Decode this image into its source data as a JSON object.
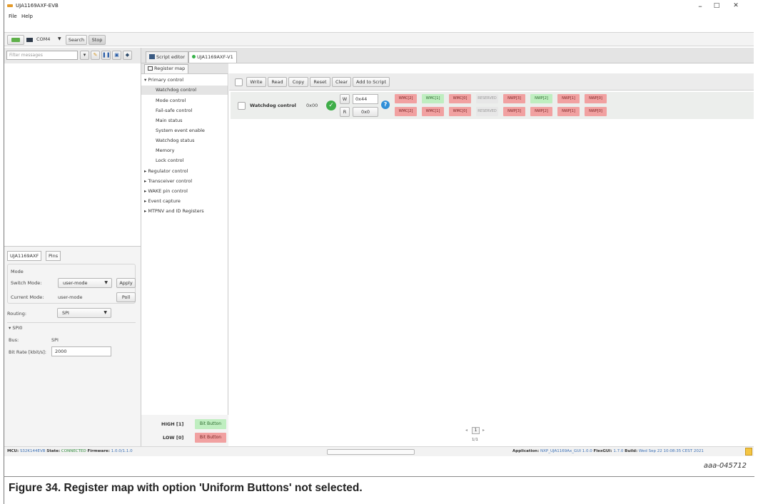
{
  "window": {
    "title": "UJA1169AXF-EVB",
    "min": "–",
    "max": "□",
    "close": "✕"
  },
  "menu": [
    "File",
    "Help"
  ],
  "toolbar": {
    "port": "COM4",
    "search": "Search",
    "stop": "Stop"
  },
  "filter": {
    "placeholder": "Filter messages"
  },
  "tabs": [
    {
      "label": "Script editor",
      "icon": "script-editor-icon"
    },
    {
      "label": "UJA1169AXF-V1",
      "icon": "green-dot-icon"
    }
  ],
  "register_map_tab": "Register map",
  "tree": {
    "groups": [
      {
        "label": "Primary control",
        "expanded": true,
        "children": [
          "Watchdog control",
          "Mode control",
          "Fail-safe control",
          "Main status",
          "System event enable",
          "Watchdog status",
          "Memory",
          "Lock control"
        ],
        "selected": 0
      },
      {
        "label": "Regulator control",
        "expanded": false
      },
      {
        "label": "Transceiver control",
        "expanded": false
      },
      {
        "label": "WAKE pin control",
        "expanded": false
      },
      {
        "label": "Event capture",
        "expanded": false
      },
      {
        "label": "MTPNV and ID Registers",
        "expanded": false
      }
    ]
  },
  "actions": [
    "Write",
    "Read",
    "Copy",
    "Reset",
    "Clear",
    "Add to Script"
  ],
  "register": {
    "name": "Watchdog control",
    "address": "0x00",
    "write_label": "W",
    "write_value": "0x44",
    "read_label": "R",
    "read_value": "0x0",
    "write_bits": [
      {
        "label": "WMC[2]",
        "state": "red"
      },
      {
        "label": "WMC[1]",
        "state": "green"
      },
      {
        "label": "WMC[0]",
        "state": "red"
      },
      {
        "label": "RESERVED",
        "state": "grey"
      },
      {
        "label": "NWP[3]",
        "state": "red"
      },
      {
        "label": "NWP[2]",
        "state": "green"
      },
      {
        "label": "NWP[1]",
        "state": "red"
      },
      {
        "label": "NWP[0]",
        "state": "red"
      }
    ],
    "read_bits": [
      {
        "label": "WMC[2]",
        "state": "red"
      },
      {
        "label": "WMC[1]",
        "state": "red"
      },
      {
        "label": "WMC[0]",
        "state": "red"
      },
      {
        "label": "RESERVED",
        "state": "grey"
      },
      {
        "label": "NWP[3]",
        "state": "red"
      },
      {
        "label": "NWP[2]",
        "state": "red"
      },
      {
        "label": "NWP[1]",
        "state": "red"
      },
      {
        "label": "NWP[0]",
        "state": "red"
      }
    ]
  },
  "left_tabs": [
    "UJA1169AXF",
    "Pins"
  ],
  "mode": {
    "section": "Mode",
    "switch_label": "Switch Mode:",
    "switch_value": "user-mode",
    "apply": "Apply",
    "current_label": "Current Mode:",
    "current_value": "user-mode",
    "poll": "Poll"
  },
  "routing": {
    "label": "Routing:",
    "value": "SPI"
  },
  "spi": {
    "section": "SPI0",
    "bus_label": "Bus:",
    "bus_value": "SPI",
    "bitrate_label": "Bit Rate [kbit/s]:",
    "bitrate_value": "2000"
  },
  "legend": {
    "high_label": "HIGH [1]",
    "low_label": "LOW [0]",
    "button": "Bit Button",
    "high_color": "#bfeec0",
    "low_color": "#f1a1a1"
  },
  "pager": {
    "page": "1",
    "count": "1/1"
  },
  "status": {
    "mcu_label": "MCU:",
    "mcu_value": "S32K144EVB",
    "state_label": "State:",
    "state_value": "CONNECTED",
    "fw_label": "Firmware:",
    "fw_value": "1.0.0/1.1.0",
    "app_label": "Application:",
    "app_value": "NXP_UJA1169Ax_GUI 1.0.0",
    "flex_label": "FlexGUI:",
    "flex_value": "1.7.0",
    "build_label": "Build:",
    "build_value": "Wed Sep 22 10:08:35 CEST 2021"
  },
  "figure": {
    "id": "aaa-045712",
    "caption": "Figure 34.  Register map with option 'Uniform Buttons' not selected."
  },
  "colors": {
    "connected": "#2e8b3a",
    "status_value": "#3a6fb5",
    "check_green": "#3fae49"
  }
}
